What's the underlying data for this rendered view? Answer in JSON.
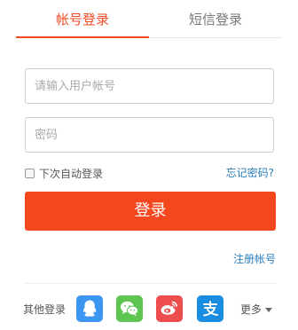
{
  "tabs": {
    "account_login": "帐号登录",
    "sms_login": "短信登录"
  },
  "form": {
    "username_placeholder": "请输入用户帐号",
    "password_placeholder": "密码",
    "remember_label": "下次自动登录",
    "forgot_password": "忘记密码?",
    "login_button": "登录",
    "register_link": "注册帐号"
  },
  "other_login": {
    "label": "其他登录",
    "providers": [
      {
        "name": "qq-icon",
        "color": "#3d95f2"
      },
      {
        "name": "wechat-icon",
        "color": "#5ec552"
      },
      {
        "name": "weibo-icon",
        "color": "#ee4d4d"
      },
      {
        "name": "alipay-icon",
        "color": "#1a8de0"
      }
    ],
    "more_label": "更多"
  },
  "colors": {
    "accent": "#f04b24",
    "button": "#f5471e",
    "link": "#2a7fbd"
  }
}
